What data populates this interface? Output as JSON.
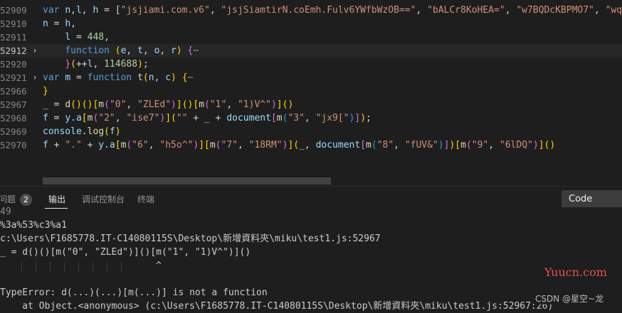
{
  "editor": {
    "lines": [
      {
        "no": "52909",
        "tokens": [
          [
            "kw",
            "var "
          ],
          [
            "var",
            "n"
          ],
          [
            "",
            ","
          ],
          [
            "var",
            "l"
          ],
          [
            "",
            ", "
          ],
          [
            "var",
            "h"
          ],
          [
            "",
            " = ["
          ],
          [
            "str",
            "\"jsjiami.com.v6\""
          ],
          [
            "",
            ", "
          ],
          [
            "str",
            "\"jsjSiamtirN.coEmh.Fulv6YWfbWzOB==\""
          ],
          [
            "",
            ", "
          ],
          [
            "str",
            "\"bALCr8KoHEA=\""
          ],
          [
            "",
            ", "
          ],
          [
            "str",
            "\"w7BQDcKBPMO7\""
          ],
          [
            "",
            ", "
          ],
          [
            "str",
            "\"wqw"
          ]
        ]
      },
      {
        "no": "52910",
        "tokens": [
          [
            "var",
            "n"
          ],
          [
            "",
            " = "
          ],
          [
            "var",
            "h"
          ],
          [
            "",
            ","
          ]
        ]
      },
      {
        "no": "52911",
        "tokens": [
          [
            "",
            "    "
          ],
          [
            "var",
            "l"
          ],
          [
            "",
            " = "
          ],
          [
            "num",
            "448"
          ],
          [
            "",
            ","
          ]
        ]
      },
      {
        "no": "52912",
        "tokens": [
          [
            "",
            "    "
          ],
          [
            "kw",
            "function "
          ],
          [
            "br1",
            "("
          ],
          [
            "var",
            "e"
          ],
          [
            "",
            ", "
          ],
          [
            "var",
            "t"
          ],
          [
            "",
            ", "
          ],
          [
            "var",
            "o"
          ],
          [
            "",
            ", "
          ],
          [
            "var",
            "r"
          ],
          [
            "br1",
            ")"
          ],
          [
            "",
            " "
          ],
          [
            "br2",
            "{"
          ],
          [
            "ellip",
            "⋯"
          ]
        ]
      },
      {
        "no": "52920",
        "tokens": [
          [
            "",
            "    "
          ],
          [
            "br2",
            "}"
          ],
          [
            "br1",
            "("
          ],
          [
            "",
            "++"
          ],
          [
            "var",
            "l"
          ],
          [
            "",
            ", "
          ],
          [
            "num",
            "114688"
          ],
          [
            "br1",
            ")"
          ],
          [
            "",
            ";"
          ]
        ]
      },
      {
        "no": "52921",
        "tokens": [
          [
            "kw",
            "var "
          ],
          [
            "var",
            "m"
          ],
          [
            "",
            " = "
          ],
          [
            "kw",
            "function "
          ],
          [
            "fn",
            "t"
          ],
          [
            "br1",
            "("
          ],
          [
            "var",
            "n"
          ],
          [
            "",
            ", "
          ],
          [
            "var",
            "c"
          ],
          [
            "br1",
            ")"
          ],
          [
            "",
            " "
          ],
          [
            "br1",
            "{"
          ],
          [
            "ellip",
            "⋯"
          ]
        ]
      },
      {
        "no": "52966",
        "tokens": [
          [
            "br1",
            "}"
          ]
        ]
      },
      {
        "no": "52967",
        "tokens": [
          [
            "var",
            "_"
          ],
          [
            "",
            " = "
          ],
          [
            "fn",
            "d"
          ],
          [
            "br1",
            "("
          ],
          [
            "br1",
            ")"
          ],
          [
            "br1",
            "("
          ],
          [
            "br1",
            ")"
          ],
          [
            "br1",
            "["
          ],
          [
            "fn",
            "m"
          ],
          [
            "br2",
            "("
          ],
          [
            "str",
            "\"0\""
          ],
          [
            "",
            ", "
          ],
          [
            "str",
            "\"ZLEd\""
          ],
          [
            "br2",
            ")"
          ],
          [
            "br1",
            "]"
          ],
          [
            "br1",
            "("
          ],
          [
            "br1",
            ")"
          ],
          [
            "br1",
            "["
          ],
          [
            "fn",
            "m"
          ],
          [
            "br2",
            "("
          ],
          [
            "str",
            "\"1\""
          ],
          [
            "",
            ", "
          ],
          [
            "str",
            "\"1)V^\""
          ],
          [
            "br2",
            ")"
          ],
          [
            "br1",
            "]"
          ],
          [
            "br1",
            "("
          ],
          [
            "br1",
            ")"
          ]
        ]
      },
      {
        "no": "52968",
        "tokens": [
          [
            "var",
            "f"
          ],
          [
            "",
            " = "
          ],
          [
            "var",
            "y"
          ],
          [
            "",
            "."
          ],
          [
            "var",
            "a"
          ],
          [
            "br1",
            "["
          ],
          [
            "fn",
            "m"
          ],
          [
            "br2",
            "("
          ],
          [
            "str",
            "\"2\""
          ],
          [
            "",
            ", "
          ],
          [
            "str",
            "\"ise7\""
          ],
          [
            "br2",
            ")"
          ],
          [
            "br1",
            "]"
          ],
          [
            "br1",
            "("
          ],
          [
            "str",
            "\"\""
          ],
          [
            "",
            " + "
          ],
          [
            "var",
            "_"
          ],
          [
            "",
            " + "
          ],
          [
            "var",
            "document"
          ],
          [
            "br2",
            "["
          ],
          [
            "fn",
            "m"
          ],
          [
            "br3",
            "("
          ],
          [
            "str",
            "\"3\""
          ],
          [
            "",
            ", "
          ],
          [
            "str",
            "\"jx9[\""
          ],
          [
            "br3",
            ")"
          ],
          [
            "br2",
            "]"
          ],
          [
            "br1",
            ")"
          ],
          [
            "",
            ";"
          ]
        ]
      },
      {
        "no": "52969",
        "tokens": [
          [
            "var",
            "console"
          ],
          [
            "",
            "."
          ],
          [
            "fn",
            "log"
          ],
          [
            "br1",
            "("
          ],
          [
            "var",
            "f"
          ],
          [
            "br1",
            ")"
          ]
        ]
      },
      {
        "no": "52970",
        "tokens": [
          [
            "var",
            "f"
          ],
          [
            "",
            " + "
          ],
          [
            "str",
            "\".\""
          ],
          [
            "",
            " + "
          ],
          [
            "var",
            "y"
          ],
          [
            "",
            "."
          ],
          [
            "var",
            "a"
          ],
          [
            "br1",
            "["
          ],
          [
            "fn",
            "m"
          ],
          [
            "br2",
            "("
          ],
          [
            "str",
            "\"6\""
          ],
          [
            "",
            ", "
          ],
          [
            "str",
            "\"h5o^\""
          ],
          [
            "br2",
            ")"
          ],
          [
            "br1",
            "]"
          ],
          [
            "br1",
            "["
          ],
          [
            "fn",
            "m"
          ],
          [
            "br2",
            "("
          ],
          [
            "str",
            "\"7\""
          ],
          [
            "",
            ", "
          ],
          [
            "str",
            "\"18RM\""
          ],
          [
            "br2",
            ")"
          ],
          [
            "br1",
            "]"
          ],
          [
            "br1",
            "("
          ],
          [
            "var",
            "_"
          ],
          [
            "",
            ", "
          ],
          [
            "var",
            "document"
          ],
          [
            "br2",
            "["
          ],
          [
            "fn",
            "m"
          ],
          [
            "br3",
            "("
          ],
          [
            "str",
            "\"8\""
          ],
          [
            "",
            ", "
          ],
          [
            "str",
            "\"fUV&\""
          ],
          [
            "br3",
            ")"
          ],
          [
            "br2",
            "]"
          ],
          [
            "br1",
            ")"
          ],
          [
            "br1",
            "["
          ],
          [
            "fn",
            "m"
          ],
          [
            "br2",
            "("
          ],
          [
            "str",
            "\"9\""
          ],
          [
            "",
            ", "
          ],
          [
            "str",
            "\"6lDQ\""
          ],
          [
            "br2",
            ")"
          ],
          [
            "br1",
            "]"
          ],
          [
            "br1",
            "("
          ],
          [
            "br1",
            ")"
          ]
        ]
      }
    ],
    "folded_lines": [
      "52912",
      "52921"
    ],
    "active_line": "52912"
  },
  "panel": {
    "tabs": [
      {
        "label": "问题",
        "badge": "2"
      },
      {
        "label": "输出"
      },
      {
        "label": "调试控制台"
      },
      {
        "label": "终端"
      }
    ],
    "channel_select": "Code",
    "output_lines": [
      "49",
      "%3a%53%c3%a1",
      "c:\\Users\\F1685778.IT-C14080115S\\Desktop\\新增資料夾\\miku\\test1.js:52967",
      "_ = d()()[m(\"0\", \"ZLEd\")]()[m(\"1\", \"1)V^\")]()",
      "                            ^",
      "",
      "TypeError: d(...)(...)[m(...)] is not a function",
      "    at Object.<anonymous> (c:\\Users\\F1685778.IT-C14080115S\\Desktop\\新增資料夾\\miku\\test1.js:52967:26)"
    ]
  },
  "watermarks": {
    "site": "Yuucn.com",
    "csdn": "CSDN @星空~龙"
  },
  "colors": {
    "background": "#1e1e1e",
    "keyword": "#569cd6",
    "variable": "#9cdcfe",
    "string": "#ce9178",
    "number": "#b5cea8",
    "function": "#dcdcaa"
  }
}
